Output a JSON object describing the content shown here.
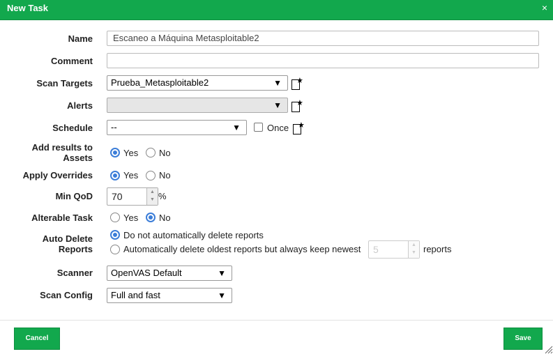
{
  "dialog": {
    "title": "New Task",
    "close_glyph": "×"
  },
  "form": {
    "name": {
      "label": "Name",
      "value": "Escaneo a Máquina Metasploitable2"
    },
    "comment": {
      "label": "Comment",
      "value": ""
    },
    "scan_targets": {
      "label": "Scan Targets",
      "value": "Prueba_Metasploitable2",
      "new_icon": "new-target-icon"
    },
    "alerts": {
      "label": "Alerts",
      "value": "",
      "new_icon": "new-alert-icon"
    },
    "schedule": {
      "label": "Schedule",
      "value": "--",
      "once_label": "Once",
      "once_checked": false,
      "new_icon": "new-schedule-icon"
    },
    "add_results": {
      "label_line1": "Add results to",
      "label_line2": "Assets",
      "yes": "Yes",
      "no": "No",
      "selected": "Yes"
    },
    "apply_overrides": {
      "label": "Apply Overrides",
      "yes": "Yes",
      "no": "No",
      "selected": "Yes"
    },
    "min_qod": {
      "label": "Min QoD",
      "value": "70",
      "unit": "%"
    },
    "alterable_task": {
      "label": "Alterable Task",
      "yes": "Yes",
      "no": "No",
      "selected": "No"
    },
    "auto_delete": {
      "label_line1": "Auto Delete",
      "label_line2": "Reports",
      "option_keep": "Do not automatically delete reports",
      "option_delete": "Automatically delete oldest reports but always keep newest",
      "keep_count": "5",
      "reports_suffix": "reports",
      "selected": "keep"
    },
    "scanner": {
      "label": "Scanner",
      "value": "OpenVAS Default"
    },
    "scan_config": {
      "label": "Scan Config",
      "value": "Full and fast"
    }
  },
  "glyphs": {
    "dropdown_arrow": "▼",
    "spin_up": "▲",
    "spin_down": "▼",
    "star": "★"
  },
  "footer": {
    "cancel_label": "Cancel",
    "save_label": "Save"
  },
  "colors": {
    "accent": "#12a84d",
    "radio_selected": "#3b7dd8"
  }
}
